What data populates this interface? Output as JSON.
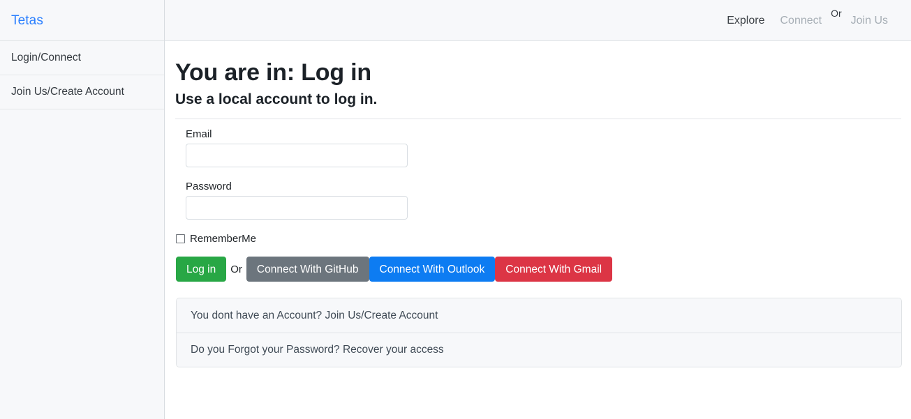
{
  "sidebar": {
    "brand": "Tetas",
    "items": [
      {
        "label": "Login/Connect"
      },
      {
        "label": "Join Us/Create Account"
      }
    ]
  },
  "topnav": {
    "explore": "Explore",
    "connect": "Connect",
    "or": "Or",
    "join_us": "Join Us"
  },
  "main": {
    "title": "You are in: Log in",
    "subtitle": "Use a local account to log in.",
    "form": {
      "email_label": "Email",
      "email_value": "",
      "email_placeholder": "",
      "password_label": "Password",
      "password_value": "",
      "password_placeholder": "",
      "remember_label": "RememberMe"
    },
    "buttons": {
      "login": "Log in",
      "or": "Or",
      "github": "Connect With GitHub",
      "outlook": "Connect With Outlook",
      "gmail": "Connect With Gmail"
    },
    "links": [
      {
        "text": "You dont have an Account? Join Us/Create Account"
      },
      {
        "text": "Do you Forgot your Password? Recover your access"
      }
    ]
  },
  "colors": {
    "brand_link": "#2a7fff",
    "login_green": "#28a745",
    "github_gray": "#6c757d",
    "outlook_blue": "#0d7cf2",
    "gmail_red": "#dc3545"
  }
}
